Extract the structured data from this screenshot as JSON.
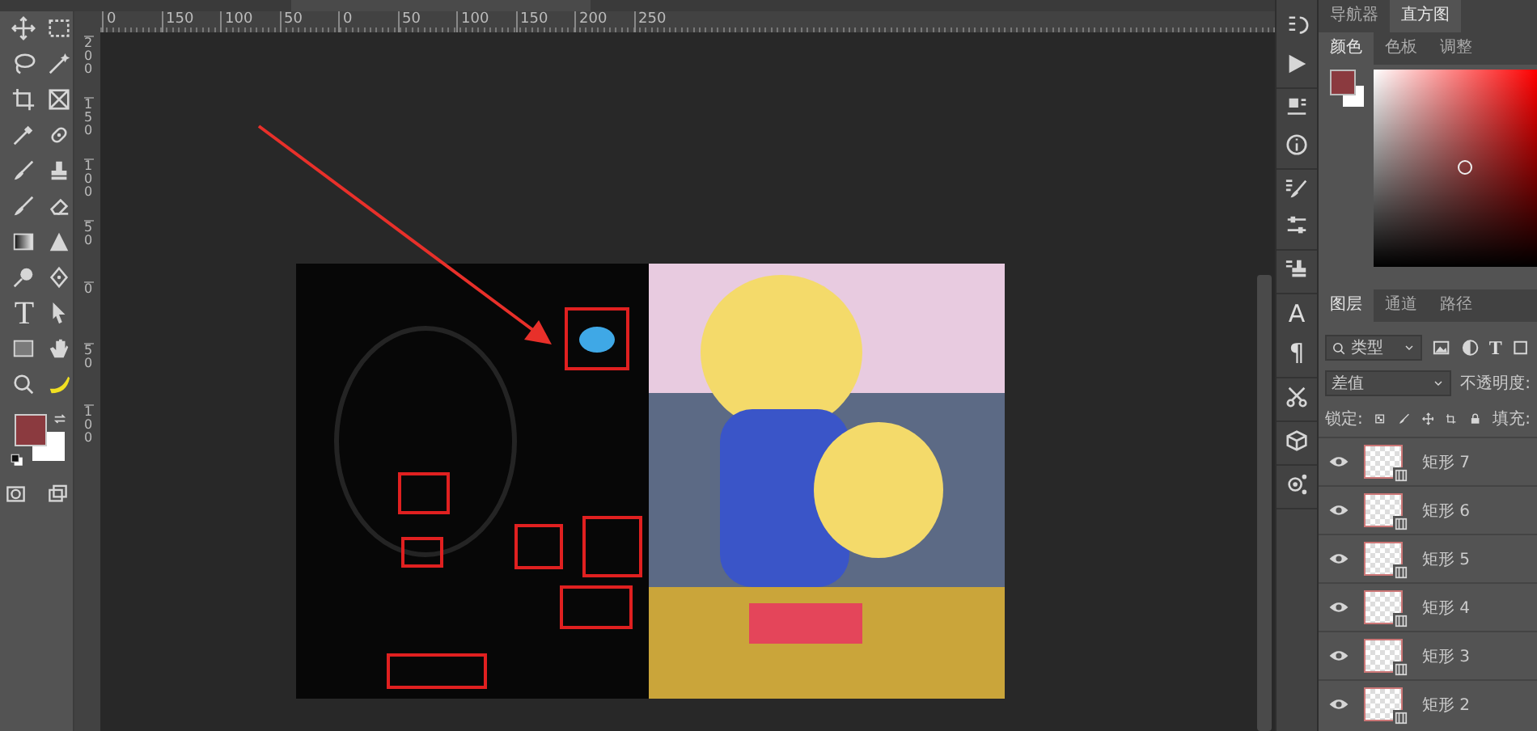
{
  "rulers": {
    "horizontal": [
      "0",
      "150",
      "100",
      "50",
      "0",
      "50",
      "100",
      "150",
      "200",
      "250"
    ],
    "vertical": [
      "200",
      "150",
      "100",
      "50",
      "0",
      "50",
      "100"
    ]
  },
  "toolbar": {
    "type_tool": "T"
  },
  "side_icons": {
    "character": "A",
    "paragraph": "¶"
  },
  "top_panel": {
    "tabs": [
      {
        "label": "导航器",
        "selected": false
      },
      {
        "label": "直方图",
        "selected": true
      }
    ]
  },
  "color_panel": {
    "tabs": [
      {
        "label": "颜色",
        "selected": true
      },
      {
        "label": "色板",
        "selected": false
      },
      {
        "label": "调整",
        "selected": false
      }
    ]
  },
  "layers_panel": {
    "tabs": [
      {
        "label": "图层",
        "selected": true
      },
      {
        "label": "通道",
        "selected": false
      },
      {
        "label": "路径",
        "selected": false
      }
    ],
    "filter": "类型",
    "type_filter": "T",
    "blend_mode": "差值",
    "opacity_label": "不透明度:",
    "lock_label": "锁定:",
    "fill_label": "填充:",
    "layers": [
      {
        "name": "矩形 7",
        "visible": true
      },
      {
        "name": "矩形 6",
        "visible": true
      },
      {
        "name": "矩形 5",
        "visible": true
      },
      {
        "name": "矩形 4",
        "visible": true
      },
      {
        "name": "矩形 3",
        "visible": true
      },
      {
        "name": "矩形 2",
        "visible": true
      }
    ]
  }
}
